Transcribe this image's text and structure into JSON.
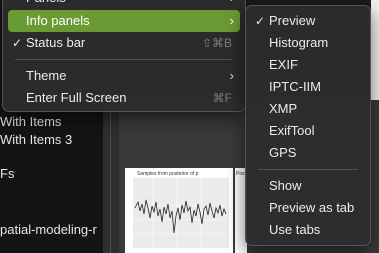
{
  "background": {
    "list_items": [
      "With Items",
      "With Items 3",
      "Fs",
      "patial-modeling-r"
    ],
    "plot_title": "Samples from posterior of p",
    "plot2_title": "Pos"
  },
  "main_menu": {
    "items": [
      {
        "label": "Panels",
        "has_submenu": true
      },
      {
        "label": "Info panels",
        "has_submenu": true,
        "highlighted": true
      },
      {
        "label": "Status bar",
        "checked": true,
        "shortcut": "⇧⌘B"
      },
      {
        "label": "Theme",
        "has_submenu": true
      },
      {
        "label": "Enter Full Screen",
        "shortcut": "⌘F"
      }
    ]
  },
  "info_panels_submenu": {
    "items": [
      {
        "label": "Preview",
        "checked": true
      },
      {
        "label": "Histogram"
      },
      {
        "label": "EXIF"
      },
      {
        "label": "IPTC-IIM"
      },
      {
        "label": "XMP"
      },
      {
        "label": "ExifTool"
      },
      {
        "label": "GPS"
      },
      {
        "label": "Show"
      },
      {
        "label": "Preview as tab"
      },
      {
        "label": "Use tabs"
      }
    ]
  },
  "glyphs": {
    "check": "✓",
    "submenu_arrow": "›"
  },
  "colors": {
    "highlight": "#6a9a34",
    "menu_bg": "#2c2c2e"
  }
}
